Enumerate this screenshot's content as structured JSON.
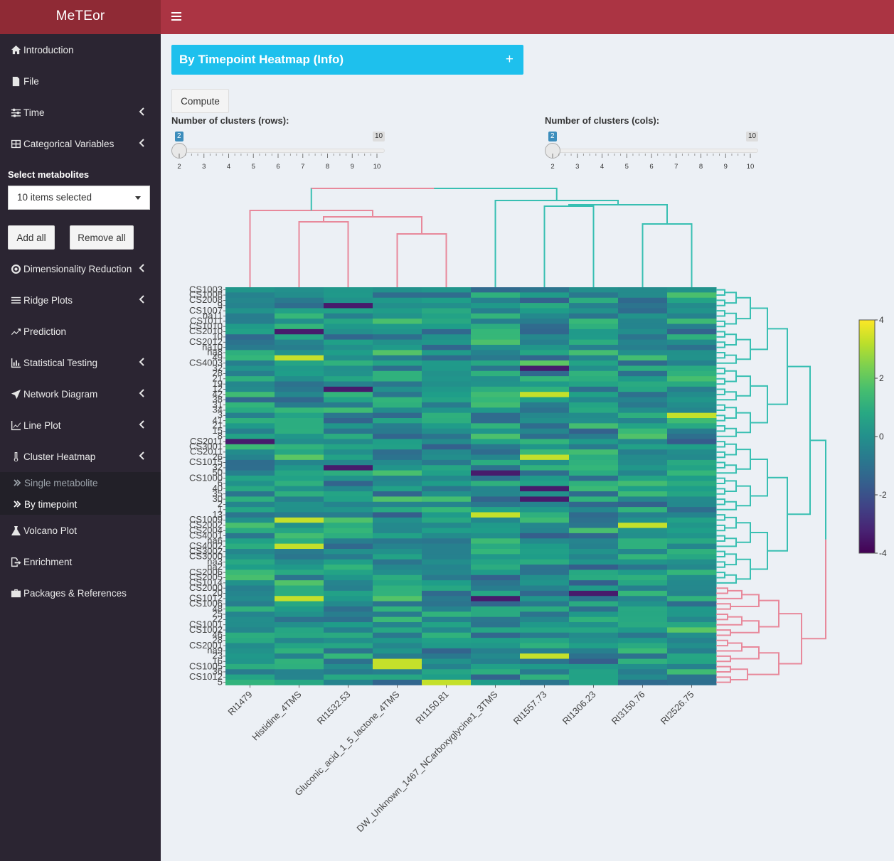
{
  "app": {
    "title": "MeTEor"
  },
  "sidebar": {
    "items": [
      {
        "label": "Introduction",
        "icon": "home-icon",
        "chevron": false
      },
      {
        "label": "File",
        "icon": "file-icon",
        "chevron": false
      },
      {
        "label": "Time",
        "icon": "sliders-icon",
        "chevron": true
      },
      {
        "label": "Categorical Variables",
        "icon": "table-icon",
        "chevron": true
      },
      {
        "label": "Dimensionality Reduction",
        "icon": "aperture-icon",
        "chevron": true
      },
      {
        "label": "Ridge Plots",
        "icon": "bars-icon",
        "chevron": true
      },
      {
        "label": "Prediction",
        "icon": "trend-icon",
        "chevron": false
      },
      {
        "label": "Statistical Testing",
        "icon": "bar-chart-icon",
        "chevron": true
      },
      {
        "label": "Network Diagram",
        "icon": "send-icon",
        "chevron": true
      },
      {
        "label": "Line Plot",
        "icon": "line-chart-icon",
        "chevron": true
      },
      {
        "label": "Cluster Heatmap",
        "icon": "thermometer-icon",
        "chevron": true
      },
      {
        "label": "Volcano Plot",
        "icon": "flask-icon",
        "chevron": false
      },
      {
        "label": "Enrichment",
        "icon": "export-icon",
        "chevron": false
      },
      {
        "label": "Packages & References",
        "icon": "briefcase-icon",
        "chevron": false
      }
    ],
    "select_metabolites_label": "Select metabolites",
    "select_value": "10 items selected",
    "add_all": "Add all",
    "remove_all": "Remove all",
    "submenu": [
      {
        "label": "Single metabolite",
        "active": false
      },
      {
        "label": "By timepoint",
        "active": true
      }
    ]
  },
  "main": {
    "info_title": "By Timepoint Heatmap (Info)",
    "info_plus": "+",
    "compute_label": "Compute",
    "slider_rows": {
      "label": "Number of clusters (rows):",
      "min": 2,
      "max": 10,
      "value": 2,
      "ticks": [
        "2",
        "3",
        "4",
        "5",
        "6",
        "7",
        "8",
        "9",
        "10"
      ]
    },
    "slider_cols": {
      "label": "Number of clusters (cols):",
      "min": 2,
      "max": 10,
      "value": 2,
      "ticks": [
        "2",
        "3",
        "4",
        "5",
        "6",
        "7",
        "8",
        "9",
        "10"
      ]
    }
  },
  "chart_data": {
    "type": "heatmap",
    "columns": [
      "RI1479",
      "Histidine_4TMS",
      "RI1532.53",
      "Gluconic_acid_1_5_lactone_4TMS",
      "RI1150.81",
      "DW_Unknown_1467_NCarboxyglycine1_3TMS",
      "RI1557.73",
      "RI1306.23",
      "RI3150.76",
      "RI2526.75"
    ],
    "row_labels": [
      "CS1003",
      "CS1008",
      "CS2008",
      "9",
      "CS1007",
      "na11",
      "CS1011",
      "CS1010",
      "CS2010",
      "10",
      "CS2012",
      "na10",
      "na8",
      "49",
      "CS4003",
      "32",
      "28",
      "21",
      "19",
      "12",
      "42",
      "38",
      "31",
      "34",
      "3",
      "41",
      "21",
      "15",
      "8",
      "CS2011",
      "CS3001",
      "CS2011",
      "26",
      "CS1015",
      "32",
      "50",
      "CS1000",
      "6",
      "40",
      "35",
      "30",
      "2",
      "1",
      "13",
      "CS1009",
      "CS2002",
      "CS2004",
      "CS4001",
      "na6",
      "CS4002",
      "CS3002",
      "CS3000",
      "na3",
      "na2",
      "CS2006",
      "CS2005",
      "CS1014",
      "CS2000",
      "20",
      "CS1012",
      "CS1006",
      "48",
      "25",
      "22",
      "CS1001",
      "CS1002",
      "46",
      "28",
      "CS2001",
      "na9",
      "23",
      "16",
      "CS1005",
      "36",
      "CS1012",
      "5"
    ],
    "colorbar": {
      "min": -4,
      "max": 4,
      "ticks": [
        4,
        2,
        0,
        -2,
        -4
      ],
      "colormap": "viridis"
    },
    "row_clusters": 2,
    "col_clusters": 2,
    "cluster_colors": [
      "#e8899b",
      "#38bfb2"
    ],
    "col_cluster_assignment": [
      0,
      0,
      0,
      0,
      0,
      1,
      1,
      1,
      1,
      1
    ]
  }
}
